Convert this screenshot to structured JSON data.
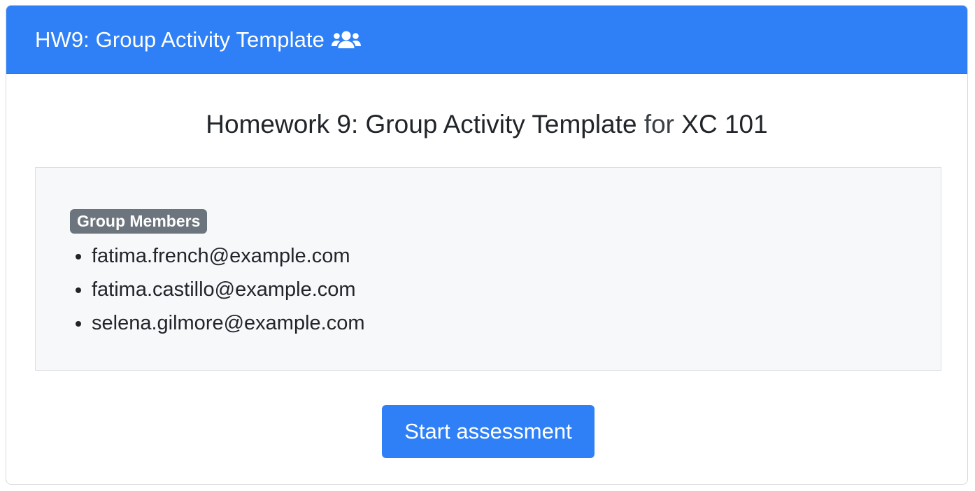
{
  "header": {
    "title": "HW9: Group Activity Template",
    "icon": "users-icon",
    "background_color": "#2f80f7"
  },
  "assessment": {
    "title_part1": "Homework 9: Group Activity Template",
    "title_for": "for",
    "course": "XC 101"
  },
  "group": {
    "badge_label": "Group Members",
    "members": [
      "fatima.french@example.com",
      "fatima.castillo@example.com",
      "selena.gilmore@example.com"
    ]
  },
  "actions": {
    "start_label": "Start assessment"
  }
}
